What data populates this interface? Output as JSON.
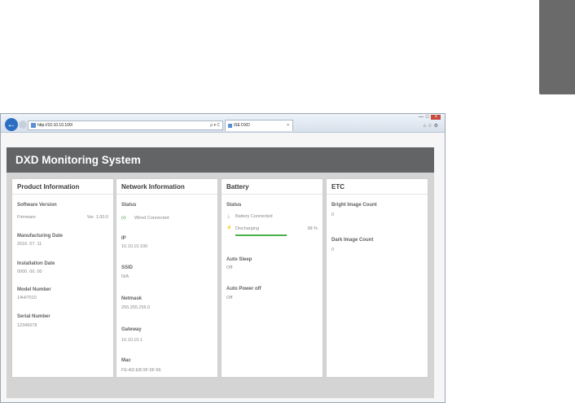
{
  "browser": {
    "url": "http://10.10.10.100/",
    "address_tools": "ρ ▾ C",
    "tab_title": "iSE DXD",
    "tab_close": "×"
  },
  "app": {
    "title": "DXD Monitoring System"
  },
  "product": {
    "title": "Product Information",
    "software_label": "Software Version",
    "firmware_label": "Firmware",
    "firmware_value": "Ver. 1.00.0",
    "mfg_label": "Manufacturing Date",
    "mfg_value": "2016. 07. 11",
    "install_label": "Installation Date",
    "install_value": "0000. 00. 00",
    "model_label": "Model Number",
    "model_value": "14HI7010",
    "serial_label": "Serial Number",
    "serial_value": "12345678"
  },
  "network": {
    "title": "Network Information",
    "status_label": "Status",
    "status_icon": "(•)",
    "status_value": "Wired Connected",
    "ip_label": "IP",
    "ip_value": "10.10.10.100",
    "ssid_label": "SSID",
    "ssid_value": "N/A",
    "netmask_label": "Netmask",
    "netmask_value": "255.255.255.0",
    "gateway_label": "Gateway",
    "gateway_value": "10.10.10.1",
    "mac_label": "Mac",
    "mac_value": "FE:AD:EB:9F:9F:66"
  },
  "battery": {
    "title": "Battery",
    "status_label": "Status",
    "connected_text": "Battery Connected",
    "discharging_text": "Discharging",
    "percent_text": "98 %",
    "level": 0.98,
    "auto_sleep_label": "Auto Sleep",
    "auto_sleep_value": "Off",
    "auto_power_label": "Auto Power off",
    "auto_power_value": "Off"
  },
  "etc": {
    "title": "ETC",
    "bright_label": "Bright Image Count",
    "bright_value": "0",
    "dark_label": "Dark Image Count",
    "dark_value": "0"
  }
}
